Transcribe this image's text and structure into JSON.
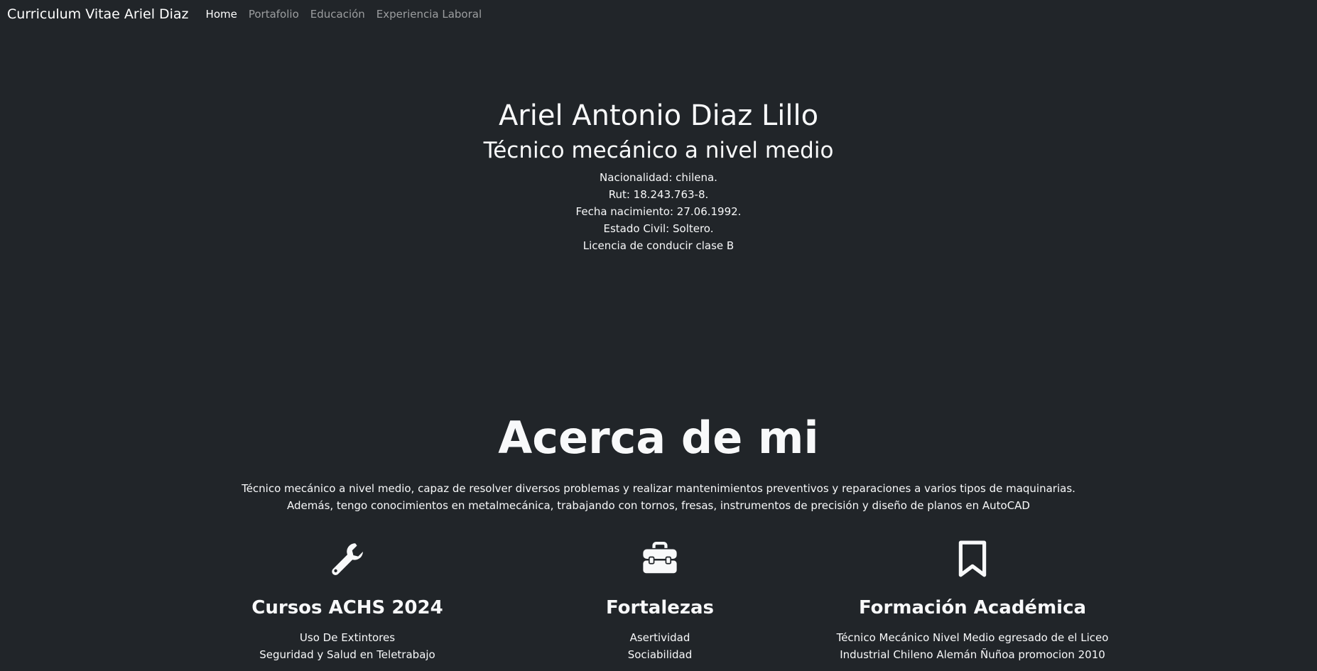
{
  "navbar": {
    "brand": "Curriculum Vitae Ariel Diaz",
    "links": [
      "Home",
      "Portafolio",
      "Educación",
      "Experiencia Laboral"
    ],
    "active": "Home"
  },
  "hero": {
    "name": "Ariel Antonio Diaz Lillo",
    "title": "Técnico mecánico a nivel medio",
    "details": [
      "Nacionalidad: chilena.",
      "Rut: 18.243.763-8.",
      "Fecha nacimiento: 27.06.1992.",
      "Estado Civil: Soltero.",
      "Licencia de conducir clase B"
    ]
  },
  "about": {
    "heading": "Acerca de mi",
    "text": "Técnico mecánico a nivel medio, capaz de resolver diversos problemas y realizar mantenimientos preventivos y reparaciones a varios tipos de maquinarias. Además, tengo conocimientos en metalmecánica, trabajando con tornos, fresas, instrumentos de precisión y diseño de planos en AutoCAD"
  },
  "features": [
    {
      "icon": "wrench-icon",
      "title": "Cursos ACHS 2024",
      "items": [
        "Uso De Extintores",
        "Seguridad y Salud en Teletrabajo"
      ]
    },
    {
      "icon": "toolbox-icon",
      "title": "Fortalezas",
      "items": [
        "Asertividad",
        "Sociabilidad"
      ]
    },
    {
      "icon": "bookmark-icon",
      "title": "Formación Académica",
      "items": [
        "Técnico Mecánico Nivel Medio egresado de el Liceo",
        "Industrial Chileno Alemán Ñuñoa promocion 2010"
      ]
    }
  ]
}
